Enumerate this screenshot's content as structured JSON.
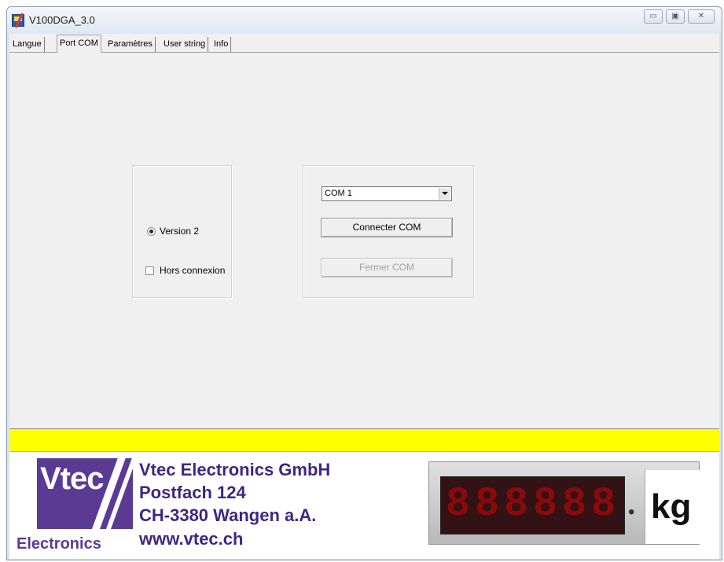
{
  "window": {
    "title": "V100DGA_3.0",
    "controls": {
      "minimize": "▭",
      "maximize": "▣",
      "close": "✕"
    }
  },
  "tabs": [
    {
      "label": "Langue",
      "active": false
    },
    {
      "label": "Port COM",
      "active": true
    },
    {
      "label": "Paramètres",
      "active": false
    },
    {
      "label": "User string",
      "active": false
    },
    {
      "label": "Info",
      "active": false
    }
  ],
  "left_group": {
    "radio_label": "Version 2",
    "radio_checked": true,
    "checkbox_label": "Hors connexion",
    "checkbox_checked": false
  },
  "right_group": {
    "port_select": "COM 1",
    "connect_button": "Connecter COM",
    "close_button": "Fermer COM"
  },
  "footer": {
    "logo_text": "Vtec",
    "logo_sub": "Electronics",
    "company": "Vtec Electronics GmbH",
    "postbox": "Postfach 124",
    "city": "CH-3380 Wangen a.A.",
    "website": "www.vtec.ch",
    "display_digits": [
      "8",
      "8",
      "8",
      "8",
      "8",
      "8"
    ],
    "unit": "kg"
  },
  "colors": {
    "status_bar": "#ffff00",
    "brand_purple": "#5b3a94",
    "display_red": "#8a0a0a"
  }
}
